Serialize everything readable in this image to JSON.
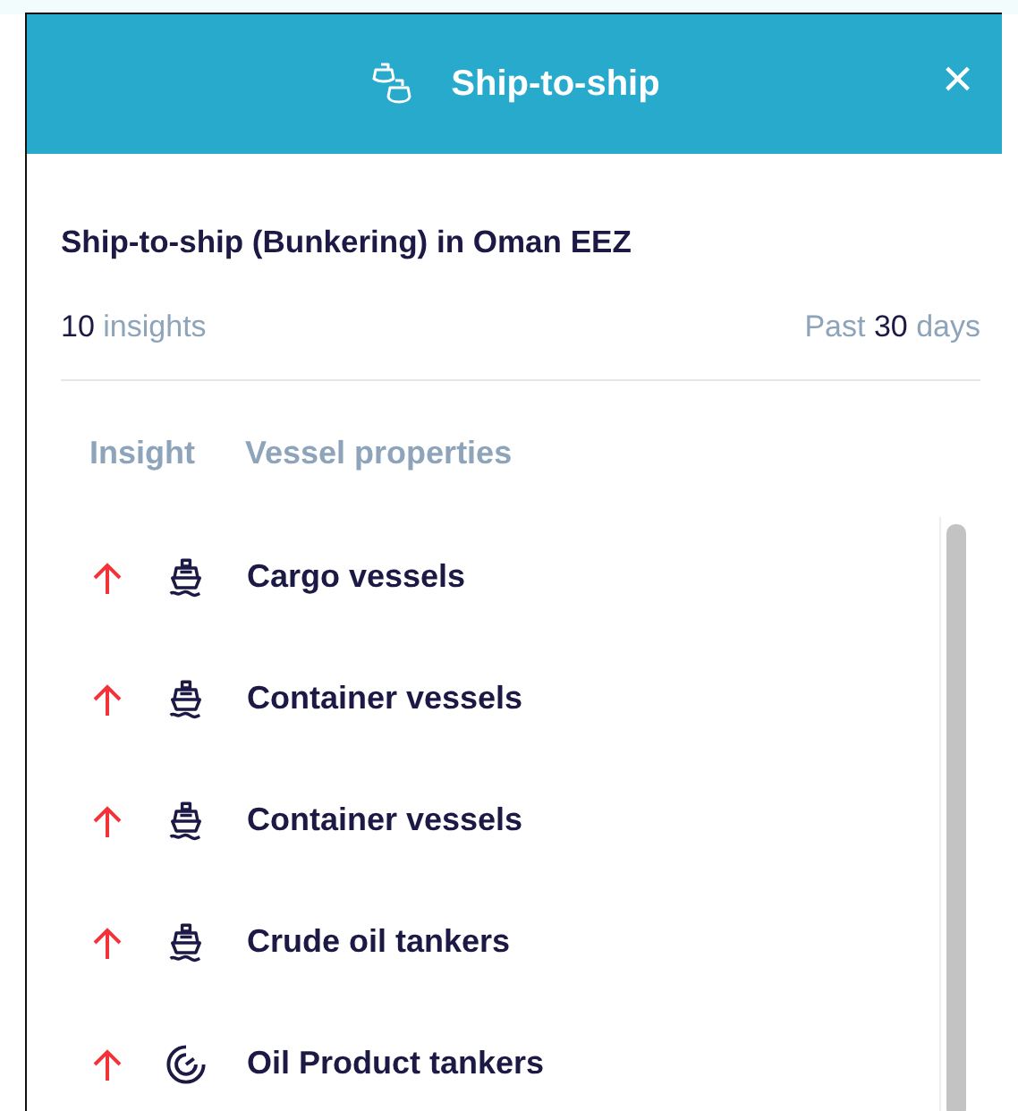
{
  "header": {
    "title": "Ship-to-ship",
    "close": "×"
  },
  "summary": {
    "title": "Ship-to-ship (Bunkering) in Oman EEZ",
    "count": "10",
    "count_label": "insights",
    "period_prefix": "Past",
    "period_value": "30",
    "period_unit": "days"
  },
  "columns": [
    "Insight",
    "Vessel properties"
  ],
  "rows": [
    {
      "rising": true,
      "kind": "ship",
      "label": "Cargo vessels"
    },
    {
      "rising": true,
      "kind": "ship",
      "label": "Container vessels"
    },
    {
      "rising": true,
      "kind": "ship",
      "label": "Container vessels"
    },
    {
      "rising": true,
      "kind": "ship",
      "label": "Crude oil tankers"
    },
    {
      "rising": true,
      "kind": "gauge",
      "label": "Oil Product tankers"
    }
  ]
}
